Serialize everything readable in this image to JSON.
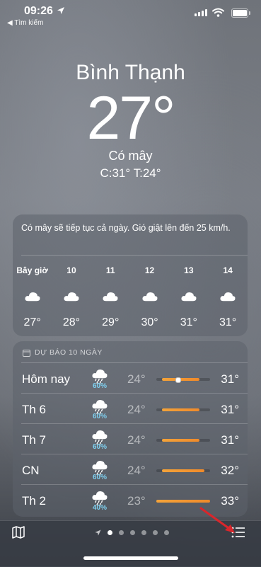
{
  "status_bar": {
    "time": "09:26",
    "back_label": "◀ Tìm kiếm"
  },
  "current": {
    "city": "Bình Thạnh",
    "temperature": "27°",
    "condition": "Có mây",
    "high_low": "C:31°  T:24°"
  },
  "hourly": {
    "summary": "Có mây sẽ tiếp tục cả ngày. Gió giật lên đến 25 km/h.",
    "hours": [
      {
        "label": "Bây giờ",
        "temp": "27°",
        "icon": "cloud-icon"
      },
      {
        "label": "10",
        "temp": "28°",
        "icon": "cloud-icon"
      },
      {
        "label": "11",
        "temp": "29°",
        "icon": "cloud-icon"
      },
      {
        "label": "12",
        "temp": "30°",
        "icon": "cloud-icon"
      },
      {
        "label": "13",
        "temp": "31°",
        "icon": "cloud-icon"
      },
      {
        "label": "14",
        "temp": "31°",
        "icon": "cloud-icon"
      }
    ]
  },
  "daily": {
    "header": "DỰ BÁO 10 NGÀY",
    "range_min": 23,
    "range_max": 33,
    "days": [
      {
        "day": "Hôm nay",
        "precip": "60%",
        "low": "24°",
        "high": "31°",
        "low_val": 24,
        "high_val": 31,
        "current_val": 27,
        "icon": "cloud-rain-icon"
      },
      {
        "day": "Th 6",
        "precip": "60%",
        "low": "24°",
        "high": "31°",
        "low_val": 24,
        "high_val": 31,
        "icon": "cloud-rain-icon"
      },
      {
        "day": "Th 7",
        "precip": "60%",
        "low": "24°",
        "high": "31°",
        "low_val": 24,
        "high_val": 31,
        "icon": "cloud-rain-icon"
      },
      {
        "day": "CN",
        "precip": "60%",
        "low": "24°",
        "high": "32°",
        "low_val": 24,
        "high_val": 32,
        "icon": "cloud-rain-icon"
      },
      {
        "day": "Th 2",
        "precip": "40%",
        "low": "23°",
        "high": "33°",
        "low_val": 23,
        "high_val": 33,
        "icon": "cloud-rain-icon"
      }
    ]
  },
  "bottom_bar": {
    "pages": 6,
    "active_page": 0
  },
  "colors": {
    "precip": "#7fd0f0",
    "temp_bar": "#f3a33a",
    "annotation": "#d9262b"
  }
}
